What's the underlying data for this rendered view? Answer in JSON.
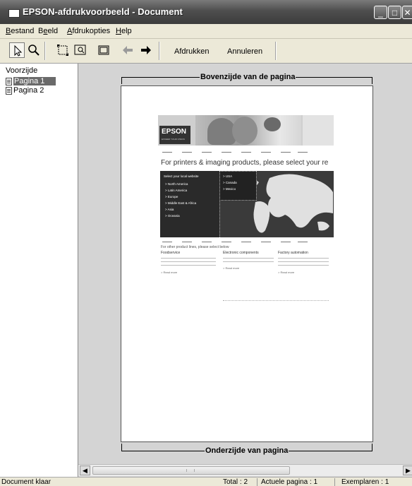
{
  "window": {
    "title": "EPSON-afdrukvoorbeeld - Document",
    "controls": [
      "minimize-icon",
      "maximize-icon",
      "close-icon"
    ]
  },
  "menu": {
    "items": [
      {
        "label": "Bestand",
        "mnemonic": "B"
      },
      {
        "label": "Beeld",
        "mnemonic": "e"
      },
      {
        "label": "Afdrukopties",
        "mnemonic": "A"
      },
      {
        "label": "Help",
        "mnemonic": "H"
      }
    ]
  },
  "toolbar": {
    "icons": [
      "pointer-icon",
      "zoom-icon",
      "fit-page-icon",
      "zoom-fit-icon",
      "frame-icon",
      "back-arrow-icon",
      "forward-arrow-icon"
    ],
    "print_label": "Afdrukken",
    "cancel_label": "Annuleren"
  },
  "sidebar": {
    "header": "Voorzijde",
    "items": [
      {
        "label": "Pagina 1",
        "selected": true
      },
      {
        "label": "Pagina 2",
        "selected": false
      }
    ]
  },
  "preview": {
    "top_label": "Bovenzijde van de pagina",
    "bottom_label": "Onderzijde van pagina",
    "thumbnail": {
      "logo": "EPSON",
      "headline": "For printers & imaging products, please select your re",
      "select_title": "Select your local website",
      "regions_left": [
        "> North America",
        "> Latin America",
        "> Europe",
        "> Middle East & Africa",
        "> Asia",
        "> Oceania"
      ],
      "regions_right": [
        "> USA",
        "> Canada",
        "> Mexico"
      ],
      "other_lines": "For other product lines, please select below",
      "columns": [
        {
          "title": "Foodservice",
          "link": "> Read more"
        },
        {
          "title": "Electronic components",
          "link": "> Read more"
        },
        {
          "title": "Factory automation",
          "link": "> Read more"
        }
      ]
    }
  },
  "status": {
    "message": "Document klaar",
    "total": "Total : 2",
    "current_page": "Actuele pagina : 1",
    "copies": "Exemplaren : 1"
  }
}
